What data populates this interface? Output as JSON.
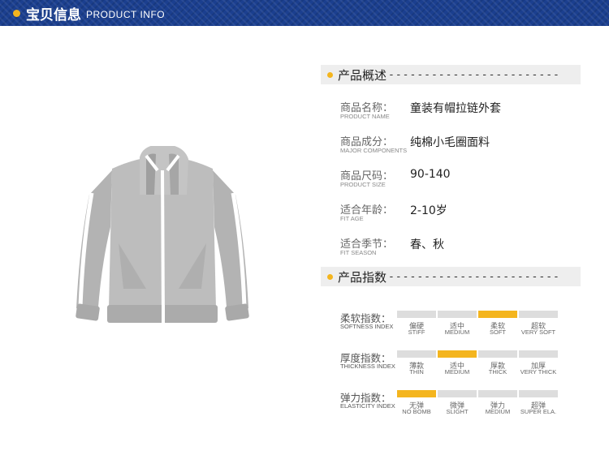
{
  "banner": {
    "title": "宝贝信息",
    "subtitle": "PRODUCT INFO"
  },
  "overview": {
    "title": "产品概述",
    "dashes": "------------------------",
    "rows": [
      {
        "label_cn": "商品名称：",
        "label_en": "PRODUCT NAME",
        "value": "童装有帽拉链外套"
      },
      {
        "label_cn": "商品成分：",
        "label_en": "MAJOR COMPONENTS",
        "value": "纯棉小毛圈面料"
      },
      {
        "label_cn": "商品尺码：",
        "label_en": "PRODUCT SIZE",
        "value": "90-140"
      },
      {
        "label_cn": "适合年龄：",
        "label_en": "FIT AGE",
        "value": "2-10岁"
      },
      {
        "label_cn": "适合季节：",
        "label_en": "FIT SEASON",
        "value": "春、秋"
      }
    ]
  },
  "index": {
    "title": "产品指数",
    "dashes": "------------------------",
    "rows": [
      {
        "label_cn": "柔软指数：",
        "label_en": "SOFTNESS INDEX",
        "selected": 2,
        "options": [
          {
            "cn": "偏硬",
            "en": "STIFF"
          },
          {
            "cn": "适中",
            "en": "MEDIUM"
          },
          {
            "cn": "柔软",
            "en": "SOFT"
          },
          {
            "cn": "超软",
            "en": "VERY SOFT"
          }
        ]
      },
      {
        "label_cn": "厚度指数：",
        "label_en": "THICKNESS INDEX",
        "selected": 1,
        "options": [
          {
            "cn": "薄款",
            "en": "THIN"
          },
          {
            "cn": "适中",
            "en": "MEDIUM"
          },
          {
            "cn": "厚款",
            "en": "THICK"
          },
          {
            "cn": "加厚",
            "en": "VERY THICK"
          }
        ]
      },
      {
        "label_cn": "弹力指数：",
        "label_en": "ELASTICITY INDEX",
        "selected": 0,
        "options": [
          {
            "cn": "无弹",
            "en": "NO BOMB"
          },
          {
            "cn": "微弹",
            "en": "SLIGHT"
          },
          {
            "cn": "弹力",
            "en": "MEDIUM"
          },
          {
            "cn": "超弹",
            "en": "SUPER ELA."
          }
        ]
      }
    ]
  },
  "colors": {
    "banner": "#1b3f8f",
    "accent": "#f4b51e",
    "bar_off": "#dddddd",
    "jacket": "#b9b9b9"
  }
}
